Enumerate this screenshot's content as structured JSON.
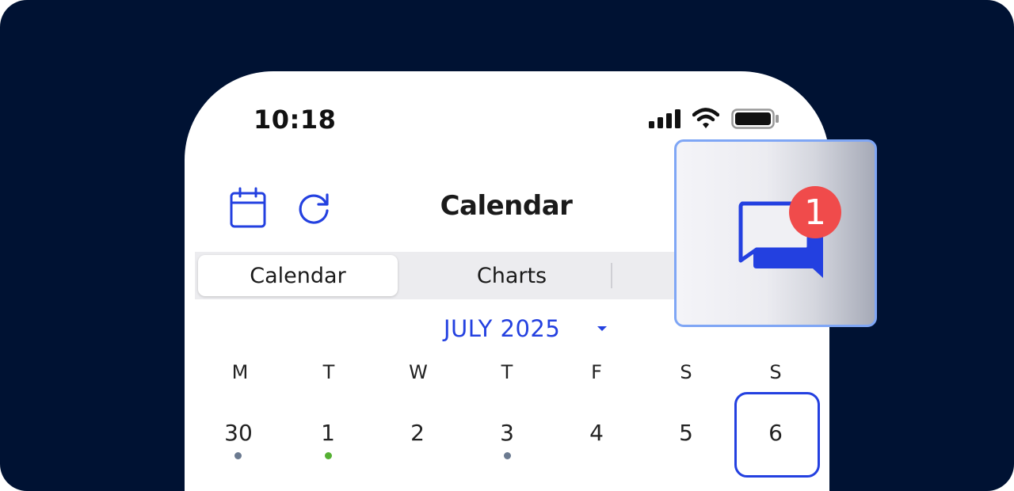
{
  "status_bar": {
    "time": "10:18"
  },
  "header": {
    "title": "Calendar",
    "left_icons": [
      "calendar-icon",
      "refresh-icon"
    ]
  },
  "segments": [
    {
      "label": "Calendar",
      "active": true
    },
    {
      "label": "Charts",
      "active": false
    }
  ],
  "month_picker": {
    "label": "JULY 2025"
  },
  "weekdays": [
    "M",
    "T",
    "W",
    "T",
    "F",
    "S",
    "S"
  ],
  "days": [
    {
      "label": "30",
      "marker": "gray"
    },
    {
      "label": "1",
      "marker": "green"
    },
    {
      "label": "2",
      "marker": ""
    },
    {
      "label": "3",
      "marker": "gray"
    },
    {
      "label": "4",
      "marker": ""
    },
    {
      "label": "5",
      "marker": ""
    },
    {
      "label": "6",
      "marker": "",
      "selected": true
    }
  ],
  "notification": {
    "icon": "chat-icon",
    "badge_count": "1"
  },
  "colors": {
    "background": "#001233",
    "accent": "#2340e0",
    "badge": "#f04b4b",
    "marker_gray": "#6b7a90",
    "marker_green": "#55b033"
  }
}
